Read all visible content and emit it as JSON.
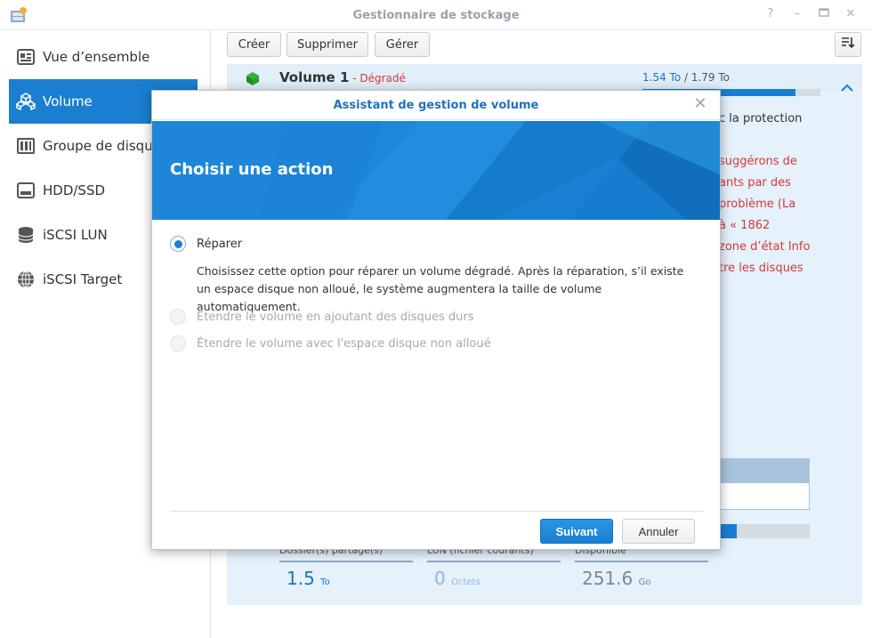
{
  "window": {
    "title": "Gestionnaire de stockage",
    "controls": [
      "help-icon",
      "minimize-icon",
      "maximize-icon",
      "close-icon"
    ]
  },
  "sidebar": {
    "items": [
      {
        "label": "Vue d’ensemble",
        "icon": "overview-icon",
        "active": false
      },
      {
        "label": "Volume",
        "icon": "volume-cubes-icon",
        "active": true
      },
      {
        "label": "Groupe de disques",
        "icon": "disk-group-icon",
        "active": false
      },
      {
        "label": "HDD/SSD",
        "icon": "hdd-icon",
        "active": false
      },
      {
        "label": "iSCSI LUN",
        "icon": "iscsi-lun-icon",
        "active": false
      },
      {
        "label": "iSCSI Target",
        "icon": "iscsi-target-icon",
        "active": false
      }
    ]
  },
  "toolbar": {
    "create_label": "Créer",
    "delete_label": "Supprimer",
    "manage_label": "Gérer"
  },
  "volume": {
    "name": "Volume 1",
    "separator": " - ",
    "status": "Dégradé",
    "used": "1.54 To",
    "total": "1.79 To",
    "usage_separator": " / ",
    "usage_fraction": 0.86
  },
  "background_text": {
    "line1": "c la protection",
    "line2": "suggérons de",
    "line3": "ants par des",
    "line4": "problème (La",
    "line5": "à « 1862",
    "line6": "zone d’état Info",
    "line7": "tre les disques"
  },
  "stats": [
    {
      "label": "Dossier(s) partagé(s)",
      "value": "1.5",
      "unit": "To"
    },
    {
      "label": "LUN (fichier courants)",
      "value": "0",
      "unit": "Octets"
    },
    {
      "label": "Disponible",
      "value": "251.6",
      "unit": "Go"
    }
  ],
  "modal": {
    "title": "Assistant de gestion de volume",
    "heading": "Choisir une action",
    "options": [
      {
        "label": "Réparer",
        "selected": true,
        "disabled": false
      },
      {
        "label": "Étendre le volume en ajoutant des disques durs",
        "selected": false,
        "disabled": true
      },
      {
        "label": "Étendre le volume avec l'espace disque non alloué",
        "selected": false,
        "disabled": true
      }
    ],
    "description": "Choisissez cette option pour réparer un volume dégradé. Après la réparation, s’il existe un espace disque non alloué, le système augmentera la taille de volume automatiquement.",
    "next_label": "Suivant",
    "cancel_label": "Annuler"
  },
  "colors": {
    "accent": "#1a7fd0",
    "warning": "#d23a3a",
    "banner": "#1d86d8"
  }
}
